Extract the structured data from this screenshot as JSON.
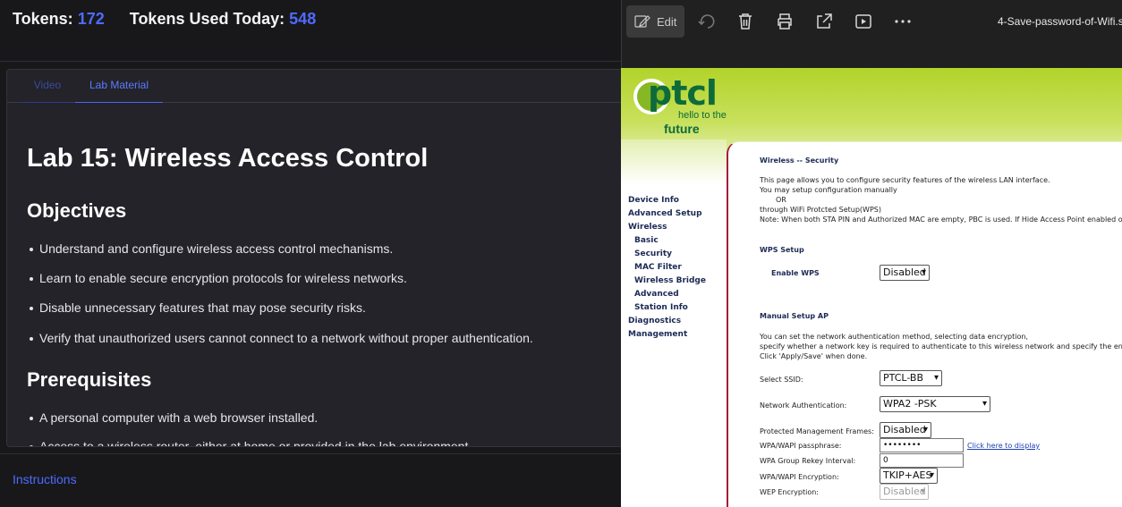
{
  "header": {
    "tokens_label": "Tokens:",
    "tokens_value": "172",
    "tokens_used_label": "Tokens Used Today:",
    "tokens_used_value": "548"
  },
  "tabs": [
    {
      "label": "Video",
      "active": false
    },
    {
      "label": "Lab Material",
      "active": true
    }
  ],
  "lab": {
    "title": "Lab 15: Wireless Access Control",
    "objectives_heading": "Objectives",
    "objectives": [
      "Understand and configure wireless access control mechanisms.",
      "Learn to enable secure encryption protocols for wireless networks.",
      "Disable unnecessary features that may pose security risks.",
      "Verify that unauthorized users cannot connect to a network without proper authentication."
    ],
    "prerequisites_heading": "Prerequisites",
    "prerequisites": [
      "A personal computer with a web browser installed.",
      "Access to a wireless router, either at home or provided in the lab environment."
    ]
  },
  "footer": {
    "instructions_link": "Instructions"
  },
  "viewer": {
    "edit_label": "Edit",
    "toolbar_icons": [
      "edit-icon",
      "rotate-icon",
      "delete-icon",
      "print-icon",
      "share-icon",
      "slideshow-icon",
      "more-icon"
    ],
    "file_name": "4-Save-password-of-Wifi.s"
  },
  "router": {
    "logo_text": "ptcl",
    "logo_tagline_1": "hello to the",
    "logo_tagline_2": "future",
    "nav": [
      "Device Info",
      "Advanced Setup",
      "Wireless",
      "Basic",
      "Security",
      "MAC Filter",
      "Wireless Bridge",
      "Advanced",
      "Station Info",
      "Diagnostics",
      "Management"
    ],
    "page_title": "Wireless -- Security",
    "intro_1": "This page allows you to configure security features of the wireless LAN interface.",
    "intro_2": "You may setup configuration manually",
    "intro_3": "OR",
    "intro_4": "through WiFi Protcted Setup(WPS)",
    "intro_5": "Note: When both STA PIN and Authorized MAC are empty, PBC is used. If Hide Access Point enabled or Mac filter list is empty",
    "wps_heading": "WPS Setup",
    "enable_wps_label": "Enable WPS",
    "enable_wps_value": "Disabled",
    "manual_heading": "Manual Setup AP",
    "manual_1": "You can set the network authentication method, selecting data encryption,",
    "manual_2": "specify whether a network key is required to authenticate to this wireless network and specify the encryption strength.",
    "manual_3": "Click 'Apply/Save' when done.",
    "ssid_label": "Select SSID:",
    "ssid_value": "PTCL-BB",
    "auth_label": "Network Authentication:",
    "auth_value": "WPA2 -PSK",
    "pmf_label": "Protected Management Frames:",
    "pmf_value": "Disabled",
    "pass_label": "WPA/WAPI passphrase:",
    "pass_value": "••••••••",
    "pass_link": "Click here to display",
    "rekey_label": "WPA Group Rekey Interval:",
    "rekey_value": "0",
    "enc_label": "WPA/WAPI Encryption:",
    "enc_value": "TKIP+AES",
    "wep_label": "WEP Encryption:",
    "wep_value": "Disabled"
  }
}
